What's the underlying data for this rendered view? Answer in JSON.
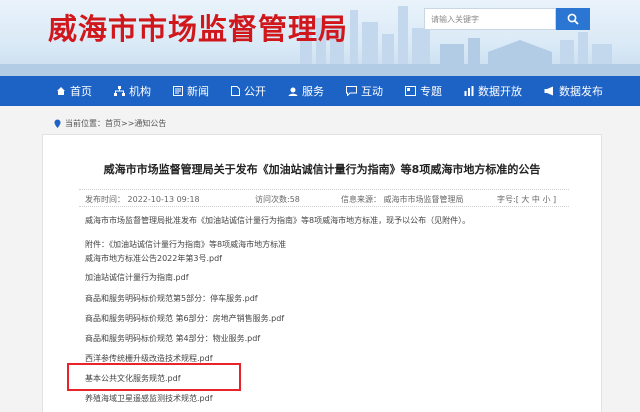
{
  "header": {
    "title": "威海市市场监督管理局",
    "search_placeholder": "请输入关键字"
  },
  "nav": {
    "items": [
      {
        "label": "首页",
        "icon": "home-icon"
      },
      {
        "label": "机构",
        "icon": "org-icon"
      },
      {
        "label": "新闻",
        "icon": "news-icon"
      },
      {
        "label": "公开",
        "icon": "doc-icon"
      },
      {
        "label": "服务",
        "icon": "service-icon"
      },
      {
        "label": "互动",
        "icon": "chat-icon"
      },
      {
        "label": "专题",
        "icon": "topic-icon"
      },
      {
        "label": "数据开放",
        "icon": "chart-icon"
      },
      {
        "label": "数据发布",
        "icon": "megaphone-icon"
      }
    ]
  },
  "breadcrumb": {
    "prefix": "当前位置：",
    "path": "首页>>通知公告"
  },
  "article": {
    "title": "威海市市场监督管理局关于发布《加油站诚信计量行为指南》等8项威海市地方标准的公告",
    "meta": {
      "published": "发布时间：  2022-10-13 09:18",
      "views": "访问次数:58",
      "source": "信息来源：  威海市市场监督管理局",
      "font_size": "字号:[ 大 中 小 ]"
    },
    "lines": [
      "威海市市场监督管理局批准发布《加油站诚信计量行为指南》等8项威海市地方标准，现予以公布（见附件）。",
      "附件：《加油站诚信计量行为指南》等8项威海市地方标准",
      "威海市地方标准公告2022年第3号.pdf",
      "加油站诚信计量行为指南.pdf",
      "商品和服务明码标价规范第5部分：停车服务.pdf",
      "商品和服务明码标价规范 第6部分：房地产销售服务.pdf",
      "商品和服务明码标价规范 第4部分：物业服务.pdf",
      "西洋参传统栅升级改造技术规程.pdf",
      "基本公共文化服务规范.pdf",
      "养殖海域卫星遥感监测技术规范.pdf"
    ]
  },
  "colors": {
    "brand_red": "#d0171c",
    "nav_blue": "#1d62c5",
    "highlight_red": "#e8232a"
  }
}
